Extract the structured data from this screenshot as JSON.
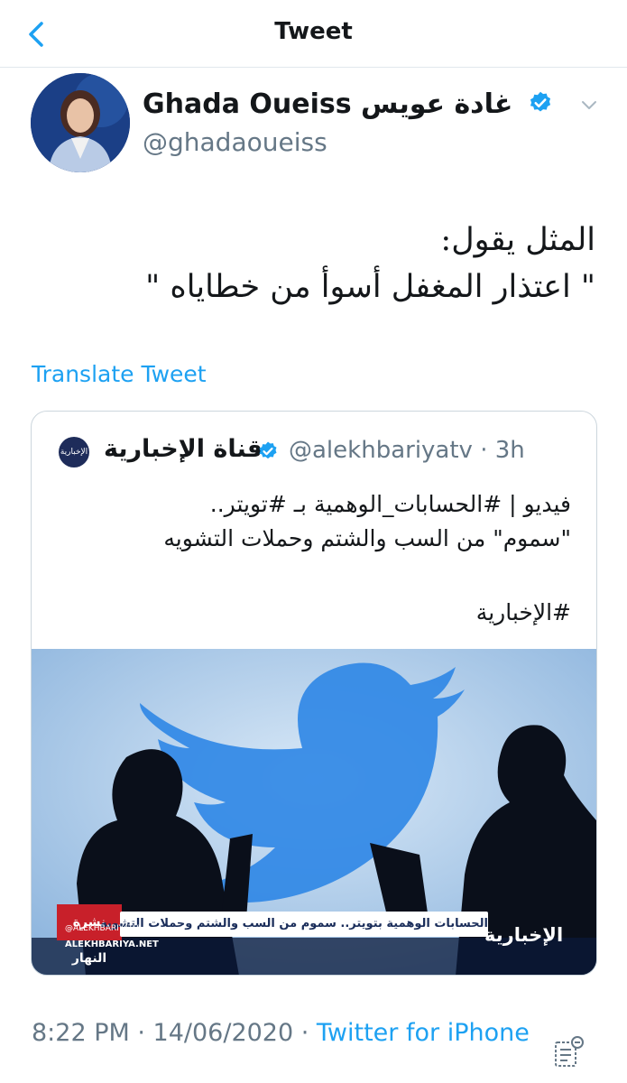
{
  "nav": {
    "title": "Tweet"
  },
  "author": {
    "display_name": "Ghada Oueiss غادة عويس",
    "handle": "@ghadaoueiss",
    "verified": true
  },
  "tweet": {
    "line1": "المثل يقول:",
    "line2": "\" اعتذار المغفل أسوأ من خطاياه \"",
    "translate_label": "Translate Tweet"
  },
  "quoted": {
    "logo_text": "الإخبارية",
    "name": "قناة الإخبارية",
    "handle_time": "@alekhbariyatv · 3h",
    "line1": "فيديو | #الحسابات_الوهمية بـ #تويتر..",
    "line2": "\"سموم\" من السب والشتم وحملات التشويه",
    "hashtag": "#الإخبارية",
    "media": {
      "lower_third": "الحسابات الوهمية بتويتر.. سموم من السب والشتم وحملات التشويه",
      "show_tag": "نشرة النهار",
      "site_handle": "@ALEKHBARIYATV",
      "site_url": "ALEKHBARIYA.NET",
      "channel_logo": "الإخبارية"
    }
  },
  "meta": {
    "time_date": "8:22 PM · 14/06/2020 · ",
    "source": "Twitter for iPhone"
  },
  "colors": {
    "accent": "#1da1f2",
    "secondary_text": "#657786",
    "border": "#e1e8ed"
  },
  "icons": [
    "back-chevron-icon",
    "verified-badge-icon",
    "chevron-down-icon",
    "tweet-activity-icon"
  ]
}
